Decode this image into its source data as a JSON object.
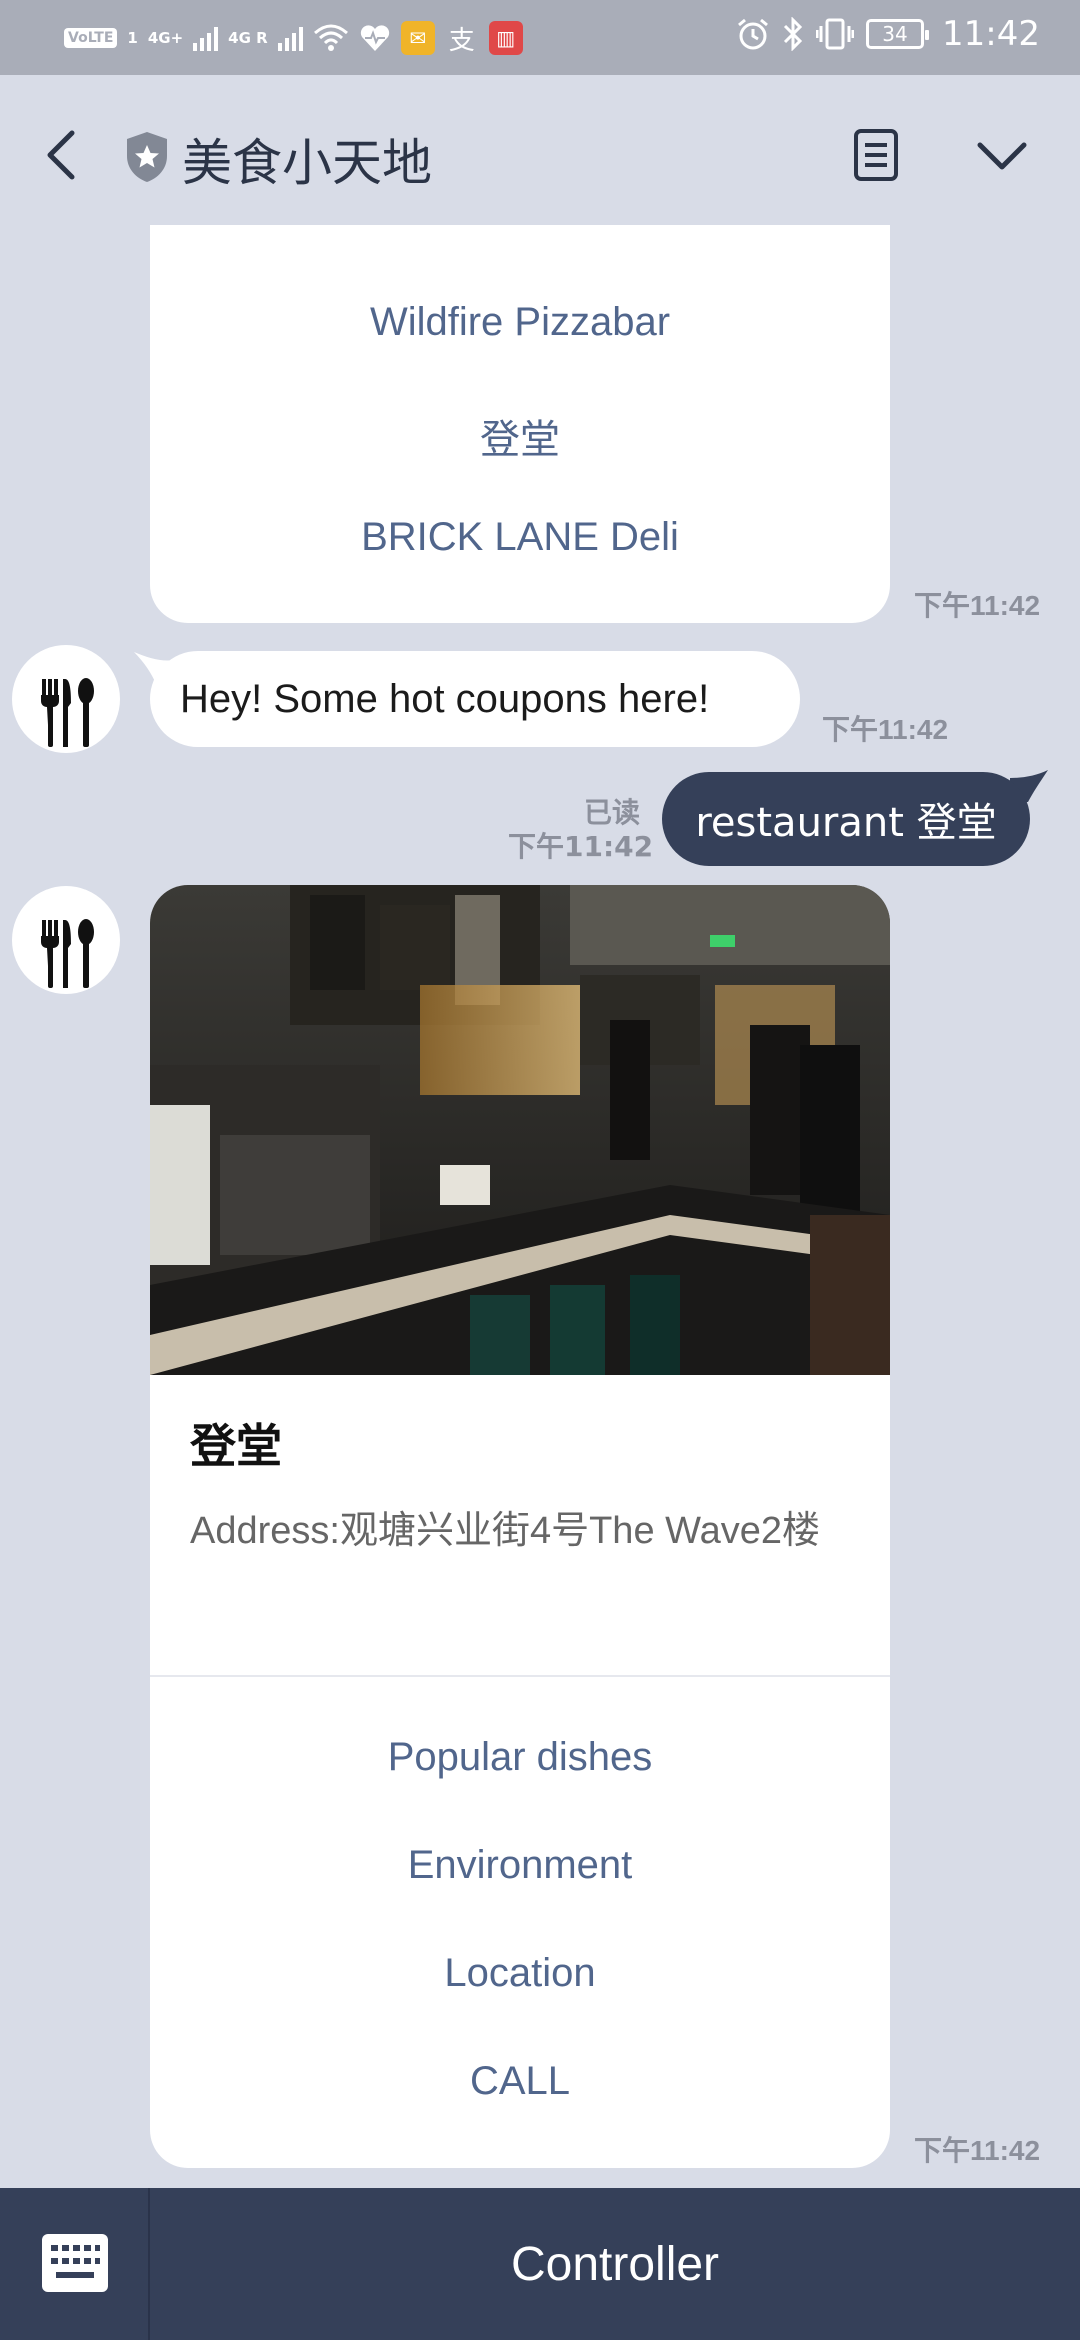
{
  "status_bar": {
    "volte": "VoLTE",
    "sim1": "1",
    "net1": "4G+",
    "net2": "4G R",
    "battery": "34",
    "time": "11:42",
    "icons": [
      "wifi-icon",
      "heart-health-icon",
      "mail-icon",
      "alipay-icon",
      "book-icon",
      "alarm-icon",
      "bluetooth-icon",
      "vibrate-icon"
    ]
  },
  "header": {
    "title": "美食小天地",
    "icons": [
      "back-icon",
      "shield-star-icon",
      "notes-icon",
      "chevron-down-icon"
    ]
  },
  "messages": {
    "top_card": {
      "links": [
        "Wildfire Pizzabar",
        "登堂",
        "BRICK LANE Deli"
      ],
      "time": "下午11:42"
    },
    "bot_text": {
      "text": "Hey! Some hot coupons here!",
      "time": "下午11:42"
    },
    "user_text": {
      "text": "restaurant 登堂",
      "read": "已读",
      "time": "下午11:42"
    },
    "restaurant_card": {
      "title": "登堂",
      "address": "Address:观塘兴业街4号The Wave2楼",
      "actions": [
        "Popular dishes",
        "Environment",
        "Location",
        "CALL"
      ],
      "time": "下午11:42"
    }
  },
  "bottom_bar": {
    "label": "Controller",
    "icons": [
      "keyboard-icon"
    ]
  },
  "colors": {
    "background": "#d8dce7",
    "status_bar": "#a9adb8",
    "link": "#51668c",
    "dark_navy": "#354059"
  }
}
